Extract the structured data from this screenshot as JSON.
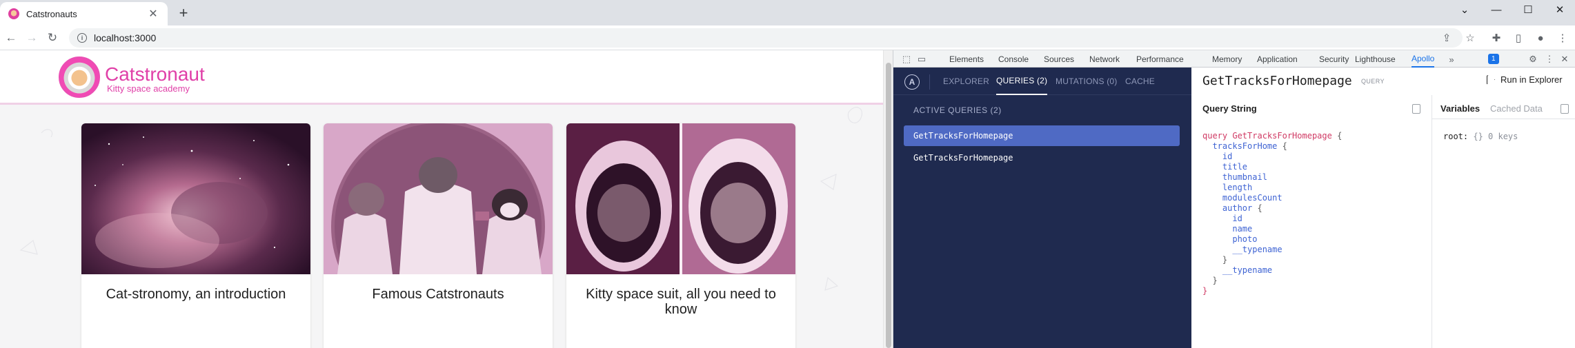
{
  "browser": {
    "tab_title": "Catstronauts",
    "url": "localhost:3000"
  },
  "site": {
    "logo_title": "Catstronaut",
    "logo_subtitle": "Kitty space academy",
    "cards": [
      {
        "title": "Cat-stronomy, an introduction"
      },
      {
        "title": "Famous Catstronauts"
      },
      {
        "title": "Kitty space suit, all you need to know"
      }
    ]
  },
  "devtools": {
    "tabs": [
      "Elements",
      "Console",
      "Sources",
      "Network",
      "Performance",
      "Memory",
      "Application",
      "Security",
      "Lighthouse",
      "Apollo"
    ],
    "active_tab": "Apollo",
    "badge": "1"
  },
  "apollo": {
    "nav": [
      "EXPLORER",
      "QUERIES (2)",
      "MUTATIONS (0)",
      "CACHE"
    ],
    "section_title": "ACTIVE QUERIES (2)",
    "queries": [
      "GetTracksForHomepage",
      "GetTracksForHomepage"
    ],
    "detail_title": "GetTracksForHomepage",
    "detail_kind": "QUERY",
    "run_label": "Run in Explorer",
    "query_string_label": "Query String",
    "variables_tab": "Variables",
    "cached_tab": "Cached Data",
    "root_key": "root:",
    "root_value": "{} 0 keys",
    "code": {
      "l1_kw": "query",
      "l1_name": "GetTracksForHomepage",
      "l1_open": "{",
      "l2": "tracksForHome",
      "fields": [
        "id",
        "title",
        "thumbnail",
        "length",
        "modulesCount"
      ],
      "author": "author",
      "author_fields": [
        "id",
        "name",
        "photo",
        "__typename"
      ],
      "typename": "__typename",
      "open": "{",
      "close": "}"
    }
  },
  "colors": {
    "brand_pink": "#e040a8",
    "apollo_navy": "#1f2a4f",
    "apollo_selected": "#4f6ac4",
    "devtools_accent": "#1a73e8"
  }
}
